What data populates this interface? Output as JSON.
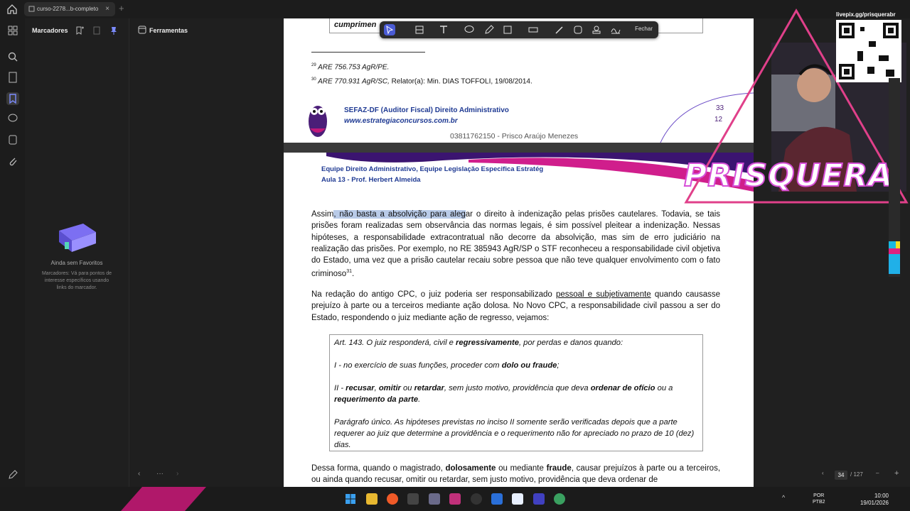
{
  "tab": {
    "title": "curso-2278...b-completo"
  },
  "sidebar": {
    "bookmarks_title": "Marcadores",
    "tools_title": "Ferramentas",
    "empty_title": "Ainda sem Favoritos",
    "empty_text": "Marcadores: Vá para pontos de interesse específicos usando links do marcador."
  },
  "toolbar": {
    "close_label": "Fechar"
  },
  "page1": {
    "line_top": "cumprimen",
    "fn29_num": "29",
    "fn29": "ARE 756.753 AgR/PE.",
    "fn30_num": "30",
    "fn30_italic": "ARE 770.931 AgR/SC,",
    "fn30_rest": " Relator(a):  Min. DIAS TOFFOLI, 19/08/2014.",
    "course": "SEFAZ-DF (Auditor Fiscal) Direito Administrativo",
    "site": "www.estrategiaconcursos.com.br",
    "page_num": "33",
    "page_sub": "12",
    "owner": "03811762150 - Prisco Araújo Menezes"
  },
  "page2": {
    "team": "Equipe Direito Administrativo, Equipe Legislação Especifica Estratég",
    "lesson": "Aula 13 - Prof. Herbert Almeida",
    "p1_a": "Assim",
    "p1_hl": ", não basta a absolvição para aleg",
    "p1_b": "ar o direito à indenização pelas prisões cautelares. Todavia, se tais prisões foram realizadas sem observância das normas legais, é sim possível pleitear a indenização. Nessas hipóteses, a responsabilidade extracontratual não decorre da absolvição, mas sim de erro judiciário na realização das prisões. Por exemplo, no RE 385943 AgR/SP o STF reconheceu a responsabilidade civil objetiva do Estado, uma vez que a prisão cautelar recaiu sobre pessoa que não teve qualquer envolvimento com o fato criminoso",
    "p1_sup": "31",
    "p2_a": "Na redação do antigo CPC, o juiz poderia ser responsabilizado ",
    "p2_u": "pessoal e subjetivamente",
    "p2_b": " quando causasse prejuízo à parte ou a terceiros mediante ação dolosa. No Novo CPC, a responsabilidade civil passou a ser do Estado, respondendo o juiz mediante ação de regresso, vejamos:",
    "q1_a": "Art. 143.  O juiz responderá, civil e ",
    "q1_b": "regressivamente",
    "q1_c": ", por perdas e danos quando:",
    "q2_a": "I - no exercício de suas funções, proceder com ",
    "q2_b": "dolo ou fraude",
    "q2_c": ";",
    "q3_a": "II - ",
    "q3_b": "recusar",
    "q3_c": ", ",
    "q3_d": "omitir",
    "q3_e": " ou ",
    "q3_f": "retardar",
    "q3_g": ", sem justo motivo, providência que deva ",
    "q3_h": "ordenar de ofício",
    "q3_i": " ou a ",
    "q3_j": "requerimento da parte",
    "q3_k": ".",
    "q4": "Parágrafo único.  As hipóteses previstas no inciso II somente serão verificadas depois que a parte requerer ao juiz que determine a providência e o requerimento não for apreciado no prazo de 10 (dez) dias.",
    "p3_a": "Dessa forma, quando o magistrado, ",
    "p3_b": "dolosamente",
    "p3_c": " ou mediante ",
    "p3_d": "fraude",
    "p3_e": ", causar prejuízos à parte ou a terceiros, ou ainda quando recusar, omitir ou retardar, sem justo motivo, providência que deva ordenar de"
  },
  "overlay": {
    "qr_label": "livepix.gg/prisquerabr",
    "brand": "PRISQUERA"
  },
  "pagenav": {
    "current": "34",
    "total": "127"
  },
  "taskbar": {
    "lang1": "POR",
    "lang2": "PTB2",
    "time": "10:00",
    "date": "19/01/2026"
  },
  "colors": {
    "accent": "#4a5bd4",
    "header_blue": "#1f3a93",
    "brand_pink": "#d64fd8"
  }
}
